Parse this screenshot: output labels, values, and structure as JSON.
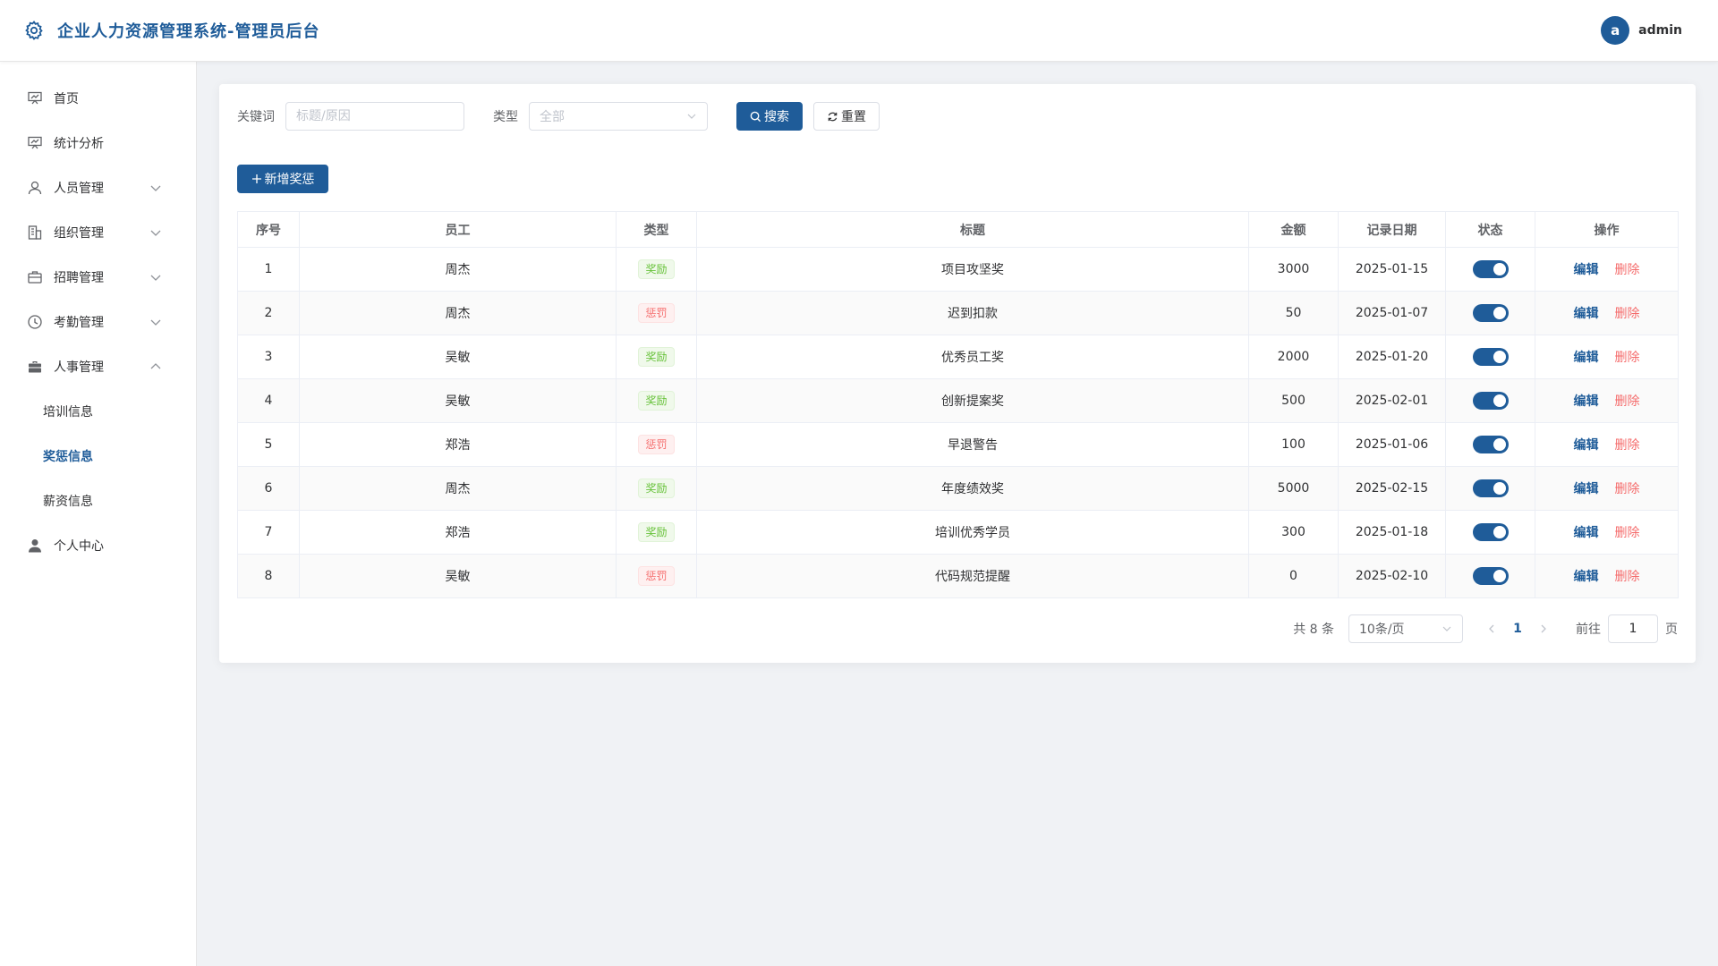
{
  "header": {
    "title": "企业人力资源管理系统-管理员后台",
    "avatar_letter": "a",
    "username": "admin"
  },
  "sidebar": {
    "items": [
      {
        "label": "首页",
        "icon": "chart-board-icon"
      },
      {
        "label": "统计分析",
        "icon": "chart-board-icon"
      },
      {
        "label": "人员管理",
        "icon": "user-icon",
        "expandable": true
      },
      {
        "label": "组织管理",
        "icon": "building-icon",
        "expandable": true
      },
      {
        "label": "招聘管理",
        "icon": "briefcase-icon",
        "expandable": true
      },
      {
        "label": "考勤管理",
        "icon": "clock-icon",
        "expandable": true
      },
      {
        "label": "人事管理",
        "icon": "suitcase-icon",
        "expanded": true
      }
    ],
    "sub_items": [
      {
        "label": "培训信息",
        "active": false
      },
      {
        "label": "奖惩信息",
        "active": true
      },
      {
        "label": "薪资信息",
        "active": false
      }
    ],
    "profile": {
      "label": "个人中心",
      "icon": "person-icon"
    }
  },
  "search": {
    "keyword_label": "关键词",
    "keyword_placeholder": "标题/原因",
    "type_label": "类型",
    "type_value": "全部",
    "search_button": "搜索",
    "reset_button": "重置"
  },
  "add_button": "新增奖惩",
  "table": {
    "columns": [
      "序号",
      "员工",
      "类型",
      "标题",
      "金额",
      "记录日期",
      "状态",
      "操作"
    ],
    "rows": [
      {
        "no": "1",
        "employee": "周杰",
        "type": "奖励",
        "kind": "reward",
        "title": "项目攻坚奖",
        "amount": "3000",
        "date": "2025-01-15",
        "enabled": true
      },
      {
        "no": "2",
        "employee": "周杰",
        "type": "惩罚",
        "kind": "punish",
        "title": "迟到扣款",
        "amount": "50",
        "date": "2025-01-07",
        "enabled": true
      },
      {
        "no": "3",
        "employee": "吴敏",
        "type": "奖励",
        "kind": "reward",
        "title": "优秀员工奖",
        "amount": "2000",
        "date": "2025-01-20",
        "enabled": true
      },
      {
        "no": "4",
        "employee": "吴敏",
        "type": "奖励",
        "kind": "reward",
        "title": "创新提案奖",
        "amount": "500",
        "date": "2025-02-01",
        "enabled": true
      },
      {
        "no": "5",
        "employee": "郑浩",
        "type": "惩罚",
        "kind": "punish",
        "title": "早退警告",
        "amount": "100",
        "date": "2025-01-06",
        "enabled": true
      },
      {
        "no": "6",
        "employee": "周杰",
        "type": "奖励",
        "kind": "reward",
        "title": "年度绩效奖",
        "amount": "5000",
        "date": "2025-02-15",
        "enabled": true
      },
      {
        "no": "7",
        "employee": "郑浩",
        "type": "奖励",
        "kind": "reward",
        "title": "培训优秀学员",
        "amount": "300",
        "date": "2025-01-18",
        "enabled": true
      },
      {
        "no": "8",
        "employee": "吴敏",
        "type": "惩罚",
        "kind": "punish",
        "title": "代码规范提醒",
        "amount": "0",
        "date": "2025-02-10",
        "enabled": true
      }
    ],
    "edit_label": "编辑",
    "delete_label": "删除"
  },
  "pagination": {
    "total": "共 8 条",
    "page_size": "10条/页",
    "current_page": "1",
    "goto_prefix": "前往",
    "goto_value": "1",
    "goto_suffix": "页"
  },
  "colors": {
    "primary": "#1f5c99",
    "reward": "#67c23a",
    "punish": "#f56c6c"
  }
}
